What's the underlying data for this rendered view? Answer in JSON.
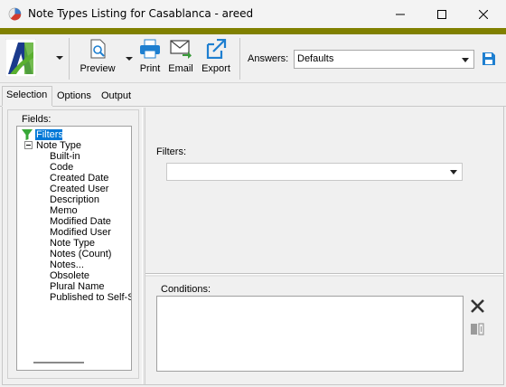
{
  "window": {
    "title": "Note Types Listing for Casablanca - areed",
    "minimize_icon": "minimize-icon",
    "maximize_icon": "maximize-icon",
    "close_icon": "close-icon"
  },
  "colors": {
    "accent_strip": "#808000",
    "selection": "#0078d7",
    "logo_blue": "#1a3a8c",
    "logo_green": "#5ab030",
    "action_blue": "#1e7fd0"
  },
  "toolbar": {
    "logo_icon": "app-logo-icon",
    "preview_label": "Preview",
    "print_label": "Print",
    "email_label": "Email",
    "export_label": "Export",
    "answers_label": "Answers:",
    "answers_value": "Defaults",
    "save_icon": "save-icon"
  },
  "tabs": [
    {
      "label": "Selection",
      "active": true
    },
    {
      "label": "Options",
      "active": false
    },
    {
      "label": "Output",
      "active": false
    }
  ],
  "fields": {
    "group_label": "Fields:",
    "root": {
      "label": "Filters",
      "icon": "funnel-icon"
    },
    "node": {
      "label": "Note Type",
      "expander": "−"
    },
    "items": [
      "Built-in",
      "Code",
      "Created Date",
      "Created User",
      "Description",
      "Memo",
      "Modified Date",
      "Modified User",
      "Note Type",
      "Notes (Count)",
      "Notes...",
      "Obsolete",
      "Plural Name",
      "Published to Self-S"
    ]
  },
  "filters": {
    "label": "Filters:",
    "value": ""
  },
  "conditions": {
    "label": "Conditions:",
    "delete_icon": "delete-icon",
    "edit_icon": "edit-icon"
  }
}
